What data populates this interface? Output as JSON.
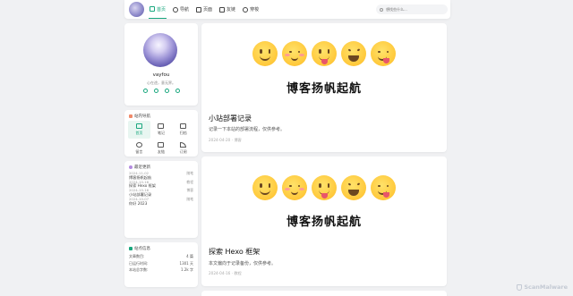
{
  "header": {
    "nav": [
      {
        "label": "首页",
        "icon": "home-icon",
        "active": true
      },
      {
        "label": "导航",
        "icon": "compass-icon"
      },
      {
        "label": "页面",
        "icon": "flask-icon"
      },
      {
        "label": "友链",
        "icon": "bell-icon"
      },
      {
        "label": "穿梭",
        "icon": "shuttle-icon"
      }
    ],
    "search_placeholder": "想找些什么..."
  },
  "profile": {
    "name": "vayfou",
    "bio": "心在途，意无界。",
    "social_icons": [
      "github-icon",
      "rss-icon",
      "clock-icon",
      "wechat-icon"
    ]
  },
  "quicknav": {
    "title": "站内导航",
    "items": [
      {
        "label": "首页",
        "icon": "home-icon",
        "active": true
      },
      {
        "label": "笔记",
        "icon": "notebook-icon"
      },
      {
        "label": "归档",
        "icon": "archive-icon"
      },
      {
        "label": "留言",
        "icon": "message-icon"
      },
      {
        "label": "友链",
        "icon": "link-icon"
      },
      {
        "label": "订阅",
        "icon": "rss-icon"
      }
    ]
  },
  "recent": {
    "title": "最近更新",
    "items": [
      {
        "date": "2024-11-02",
        "tag": "随笔",
        "title": "博客扬帆起航"
      },
      {
        "date": "2024-10-16",
        "tag": "教程",
        "title": "探索 Hexo 框架"
      },
      {
        "date": "2024-10-16",
        "tag": "博客",
        "title": "小站部署记录"
      },
      {
        "date": "2024-10-07",
        "tag": "随笔",
        "title": "你好 2023"
      }
    ]
  },
  "stats": {
    "title": "站点信息",
    "rows": [
      {
        "label": "文章数目:",
        "value": "4 篇"
      },
      {
        "label": "已运行时间:",
        "value": "1301 天"
      },
      {
        "label": "本站总字数:",
        "value": "1.2k 字"
      }
    ]
  },
  "posts": [
    {
      "banner": "博客扬帆起航",
      "title": "小站部署记录",
      "desc": "记录一下本站的部署流程，仅供参考。",
      "meta": "2024-04-20 · 博客"
    },
    {
      "banner": "博客扬帆起航",
      "title": "探索 Hexo 框架",
      "desc": "本文偏向于记录备份，仅供参考。",
      "meta": "2024-04-16 · 教程"
    }
  ],
  "watermark": "ScanMalware",
  "colors": {
    "accent": "#19a77e",
    "background": "#f0f1f3"
  }
}
